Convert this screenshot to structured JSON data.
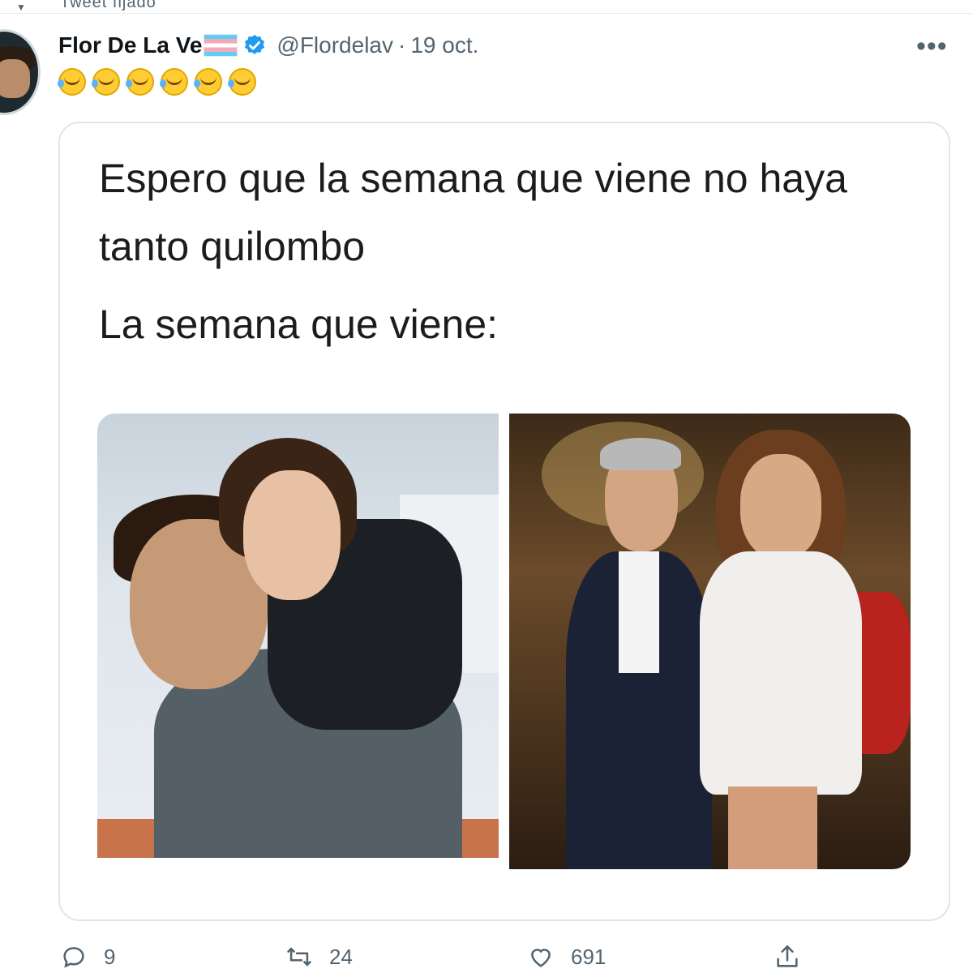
{
  "pinned": {
    "label": "Tweet fijado"
  },
  "tweet": {
    "author_name": "Flor De La Ve",
    "handle": "@Flordelav",
    "separator": "·",
    "date": "19 oct.",
    "more_label": "•••",
    "emojis": [
      "rolling-on-floor-laughing",
      "rolling-on-floor-laughing",
      "rolling-on-floor-laughing",
      "rolling-on-floor-laughing",
      "rolling-on-floor-laughing",
      "rolling-on-floor-laughing"
    ]
  },
  "meme": {
    "line1": "Espero que la semana que viene no haya tanto quilombo",
    "line2": "La semana que viene:"
  },
  "actions": {
    "reply_count": "9",
    "retweet_count": "24",
    "like_count": "691"
  },
  "colors": {
    "verified": "#1d9bf0",
    "muted": "#536471"
  }
}
